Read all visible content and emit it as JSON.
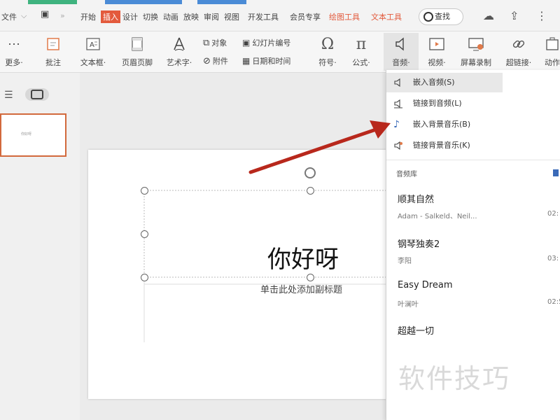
{
  "menu": {
    "file": "文件",
    "items": [
      "开始",
      "插入",
      "设计",
      "切换",
      "动画",
      "放映",
      "审阅",
      "视图",
      "开发工具",
      "会员专享",
      "绘图工具",
      "文本工具"
    ],
    "search": "查找"
  },
  "ribbon": {
    "more": "更多",
    "comment": "批注",
    "textbox": "文本框",
    "header_footer": "页眉页脚",
    "wordart": "艺术字",
    "object": "对象",
    "attachment": "附件",
    "slide_number": "幻灯片编号",
    "date_time": "日期和时间",
    "symbol": "符号",
    "formula": "公式",
    "audio": "音频",
    "video": "视频",
    "screen_record": "屏幕录制",
    "hyperlink": "超链接",
    "action": "动作"
  },
  "dropdown": {
    "items": [
      "嵌入音频(S)",
      "链接到音频(L)",
      "嵌入背景音乐(B)",
      "链接背景音乐(K)"
    ],
    "section": "音频库",
    "songs": [
      {
        "title": "顺其自然",
        "artist": "Adam - Salkeld、Neil...",
        "duration": "02:"
      },
      {
        "title": "钢琴独奏2",
        "artist": "李阳",
        "duration": "03:"
      },
      {
        "title": "Easy Dream",
        "artist": "叶澜叶",
        "duration": "02:5"
      },
      {
        "title": "超越一切",
        "artist": "",
        "duration": ""
      }
    ]
  },
  "slide": {
    "title": "你好呀",
    "subtitle": "单击此处添加副标题"
  },
  "watermark": "软件技巧",
  "colors": {
    "accent": "#e35a3c",
    "arrow": "#b8281c",
    "thumb_border": "#d2693c"
  }
}
